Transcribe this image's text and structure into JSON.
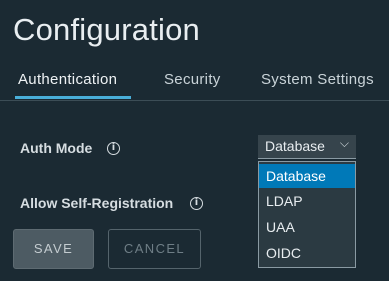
{
  "page": {
    "title": "Configuration"
  },
  "tabs": [
    {
      "label": "Authentication",
      "active": true
    },
    {
      "label": "Security",
      "active": false
    },
    {
      "label": "System Settings",
      "active": false
    }
  ],
  "form": {
    "auth_mode_label": "Auth Mode",
    "allow_self_registration_label": "Allow Self-Registration",
    "info_icon_glyph": "i"
  },
  "auth_mode_select": {
    "value": "Database",
    "chevron": "⌵",
    "options": [
      "Database",
      "LDAP",
      "UAA",
      "OIDC"
    ],
    "selected_index": 0
  },
  "buttons": {
    "save_label": "SAVE",
    "cancel_label": "CANCEL"
  },
  "colors": {
    "background": "#1b2a33",
    "accent": "#49afd9",
    "selected_option": "#0079b8"
  }
}
